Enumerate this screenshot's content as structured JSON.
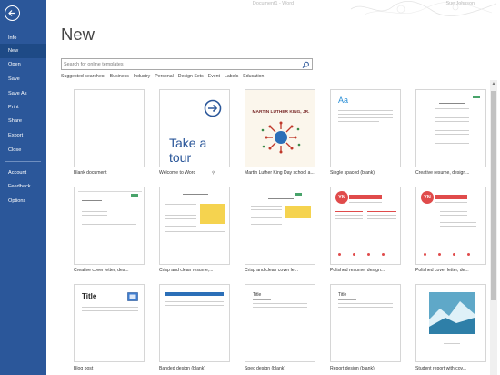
{
  "window": {
    "title": "Document1 - Word",
    "account": "Sue Johnson"
  },
  "sidebar": {
    "items": [
      {
        "label": "Info"
      },
      {
        "label": "New"
      },
      {
        "label": "Open"
      },
      {
        "label": "Save"
      },
      {
        "label": "Save As"
      },
      {
        "label": "Print"
      },
      {
        "label": "Share"
      },
      {
        "label": "Export"
      },
      {
        "label": "Close"
      },
      {
        "label": "Account"
      },
      {
        "label": "Feedback"
      },
      {
        "label": "Options"
      }
    ],
    "active": "New"
  },
  "main": {
    "heading": "New",
    "search": {
      "placeholder": "Search for online templates"
    },
    "suggested": {
      "label": "Suggested searches:",
      "links": [
        "Business",
        "Industry",
        "Personal",
        "Design Sets",
        "Event",
        "Labels",
        "Education"
      ]
    },
    "templates": [
      {
        "name": "Blank document",
        "icon": "blank-page"
      },
      {
        "name": "Welcome to Word",
        "icon": "take-a-tour",
        "thumb_text": "Take a tour"
      },
      {
        "name": "Martin Luther King Day school a...",
        "icon": "mlk-flyer",
        "thumb_text": "MARTIN LUTHER KING, JR."
      },
      {
        "name": "Single spaced (blank)",
        "icon": "single-spaced",
        "thumb_text": "Aa"
      },
      {
        "name": "Creative resume, design...",
        "icon": "resume"
      },
      {
        "name": "Creative cover letter, des...",
        "icon": "cover-letter"
      },
      {
        "name": "Crisp and clean resume,...",
        "icon": "crisp-resume"
      },
      {
        "name": "Crisp and clean cover le...",
        "icon": "crisp-cover"
      },
      {
        "name": "Polished resume, design...",
        "icon": "polished-resume",
        "thumb_text": "YN"
      },
      {
        "name": "Polished cover letter, de...",
        "icon": "polished-cover",
        "thumb_text": "YN"
      },
      {
        "name": "Blog post",
        "icon": "blog",
        "thumb_text": "Title"
      },
      {
        "name": "Banded design (blank)",
        "icon": "banded"
      },
      {
        "name": "Spec design (blank)",
        "icon": "spec",
        "thumb_text": "Title"
      },
      {
        "name": "Report design (blank)",
        "icon": "report",
        "thumb_text": "Title"
      },
      {
        "name": "Student report with cov...",
        "icon": "student-report"
      }
    ],
    "pin_glyph": "⚲"
  },
  "colors": {
    "sidebar": "#2b579a",
    "accent_blue": "#2b579a",
    "red": "#e04b4b",
    "yellow": "#f5d34f"
  }
}
